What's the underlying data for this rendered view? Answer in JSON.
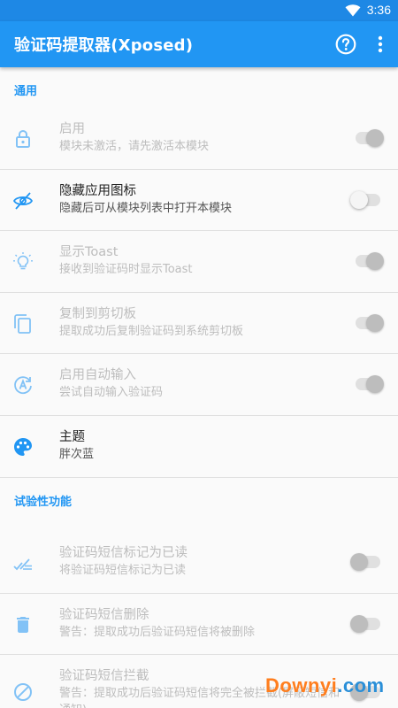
{
  "status_bar": {
    "time": "3:36"
  },
  "app_bar": {
    "title": "验证码提取器(Xposed)",
    "accent": "#2196f3"
  },
  "sections": {
    "general": {
      "header": "通用"
    },
    "experimental": {
      "header": "试验性功能"
    }
  },
  "prefs": {
    "enable": {
      "title": "启用",
      "summary": "模块未激活，请先激活本模块",
      "icon": "lock-icon",
      "switch": "on",
      "enabled": false
    },
    "hide_icon": {
      "title": "隐藏应用图标",
      "summary": "隐藏后可从模块列表中打开本模块",
      "icon": "eye-off-icon",
      "switch": "off",
      "enabled": true
    },
    "toast": {
      "title": "显示Toast",
      "summary": "接收到验证码时显示Toast",
      "icon": "lightbulb-icon",
      "switch": "on",
      "enabled": false
    },
    "copy": {
      "title": "复制到剪切板",
      "summary": "提取成功后复制验证码到系统剪切板",
      "icon": "copy-icon",
      "switch": "on",
      "enabled": false
    },
    "auto_input": {
      "title": "启用自动输入",
      "summary": "尝试自动输入验证码",
      "icon": "auto-input-icon",
      "switch": "on",
      "enabled": false
    },
    "theme": {
      "title": "主题",
      "summary": "胖次蓝",
      "icon": "palette-icon",
      "enabled": true
    },
    "mark_read": {
      "title": "验证码短信标记为已读",
      "summary": "将验证码短信标记为已读",
      "icon": "mark-read-icon",
      "switch": "off",
      "enabled": false
    },
    "delete": {
      "title": "验证码短信删除",
      "summary": "警告：提取成功后验证码短信将被删除",
      "icon": "delete-icon",
      "switch": "off",
      "enabled": false
    },
    "block": {
      "title": "验证码短信拦截",
      "summary": "警告：提取成功后验证码短信将完全被拦截(屏蔽短信和通知)",
      "icon": "block-icon",
      "switch": "off",
      "enabled": false
    }
  },
  "watermark": {
    "part1": "Downyi",
    "part2": ".com"
  }
}
